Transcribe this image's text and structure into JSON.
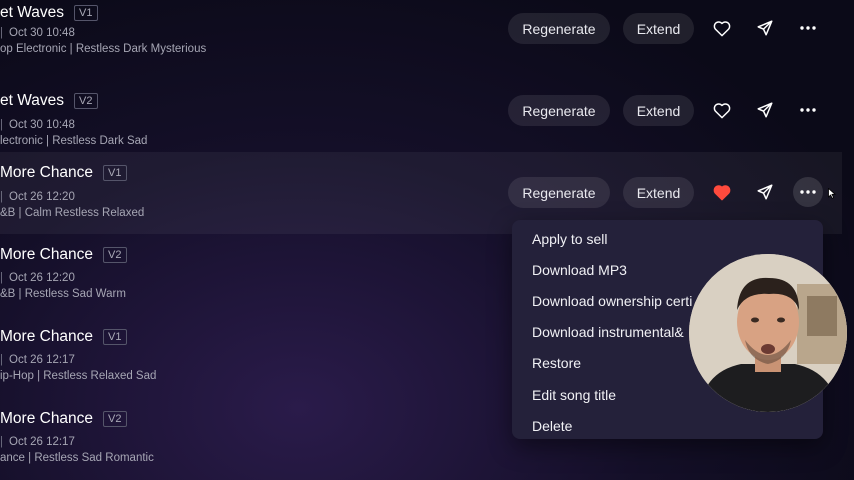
{
  "tracks": [
    {
      "title": "et Waves",
      "version": "V1",
      "date": "Oct 30 10:48",
      "tags": "op Electronic  | Restless Dark Mysterious",
      "liked": false
    },
    {
      "title": "et Waves",
      "version": "V2",
      "date": "Oct 30 10:48",
      "tags": "lectronic  | Restless Dark Sad",
      "liked": false
    },
    {
      "title": "More Chance",
      "version": "V1",
      "date": "Oct 26 12:20",
      "tags": "&B  | Calm Restless Relaxed",
      "liked": true
    },
    {
      "title": "More Chance",
      "version": "V2",
      "date": "Oct 26 12:20",
      "tags": "&B  | Restless Sad Warm",
      "liked": false
    },
    {
      "title": "More Chance",
      "version": "V1",
      "date": "Oct 26 12:17",
      "tags": "ip-Hop  | Restless Relaxed Sad",
      "liked": false
    },
    {
      "title": "More Chance",
      "version": "V2",
      "date": "Oct 26 12:17",
      "tags": "ance  | Restless Sad Romantic",
      "liked": false
    }
  ],
  "actions": {
    "regenerate": "Regenerate",
    "extend": "Extend"
  },
  "menu": {
    "items": [
      "Apply to sell",
      "Download MP3",
      "Download ownership certi",
      "Download instrumental&",
      "Restore",
      "Edit song title",
      "Delete"
    ]
  },
  "colors": {
    "liked_heart": "#ff4a3d",
    "background": "#0b0a18",
    "menu_bg": "#24213a"
  },
  "icons": [
    "heart-icon",
    "send-icon",
    "more-dots-icon",
    "cursor-icon"
  ]
}
